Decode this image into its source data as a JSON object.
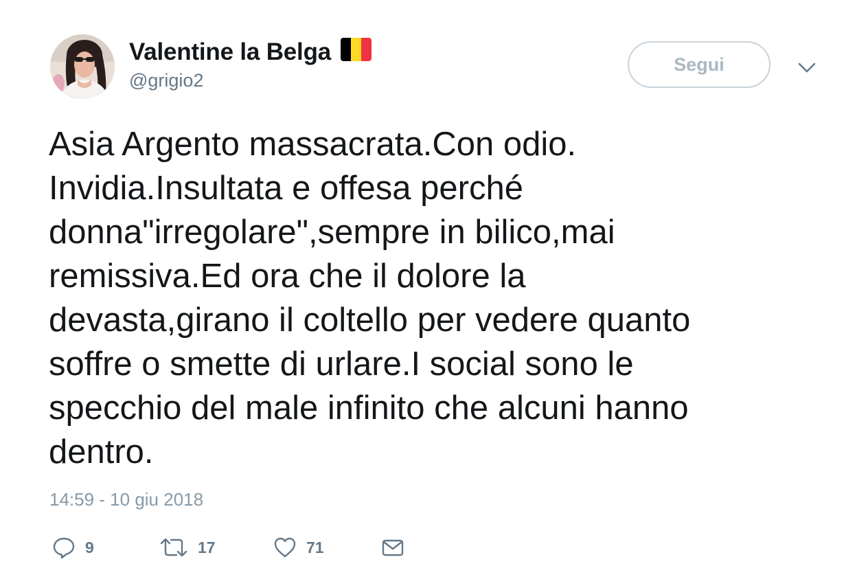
{
  "user": {
    "display_name": "Valentine la Belga",
    "handle": "@grigio2",
    "flag_colors": [
      "#000000",
      "#fdda24",
      "#ef3340"
    ]
  },
  "follow_button": {
    "label": "Segui"
  },
  "menu": {
    "icon": "chevron-down-icon"
  },
  "tweet": {
    "text_lines": [
      "Asia Argento massacrata.Con odio.",
      "Invidia.Insultata e offesa perché",
      "donna\"irregolare\",sempre in bilico,mai",
      "remissiva.Ed ora che il dolore la",
      "devasta,girano il coltello per vedere quanto",
      "soffre o smette di urlare.I social sono le",
      "specchio del male infinito che alcuni hanno",
      "dentro."
    ],
    "timestamp": "14:59 - 10 giu 2018"
  },
  "actions": {
    "reply": {
      "icon": "reply-icon",
      "count": "9"
    },
    "retweet": {
      "icon": "retweet-icon",
      "count": "17"
    },
    "like": {
      "icon": "heart-icon",
      "count": "71"
    },
    "message": {
      "icon": "envelope-icon"
    }
  },
  "colors": {
    "text": "#14171a",
    "secondary": "#657786",
    "muted": "#8899a6",
    "button_border": "#c8d2d9",
    "button_text": "#aab8c2"
  }
}
